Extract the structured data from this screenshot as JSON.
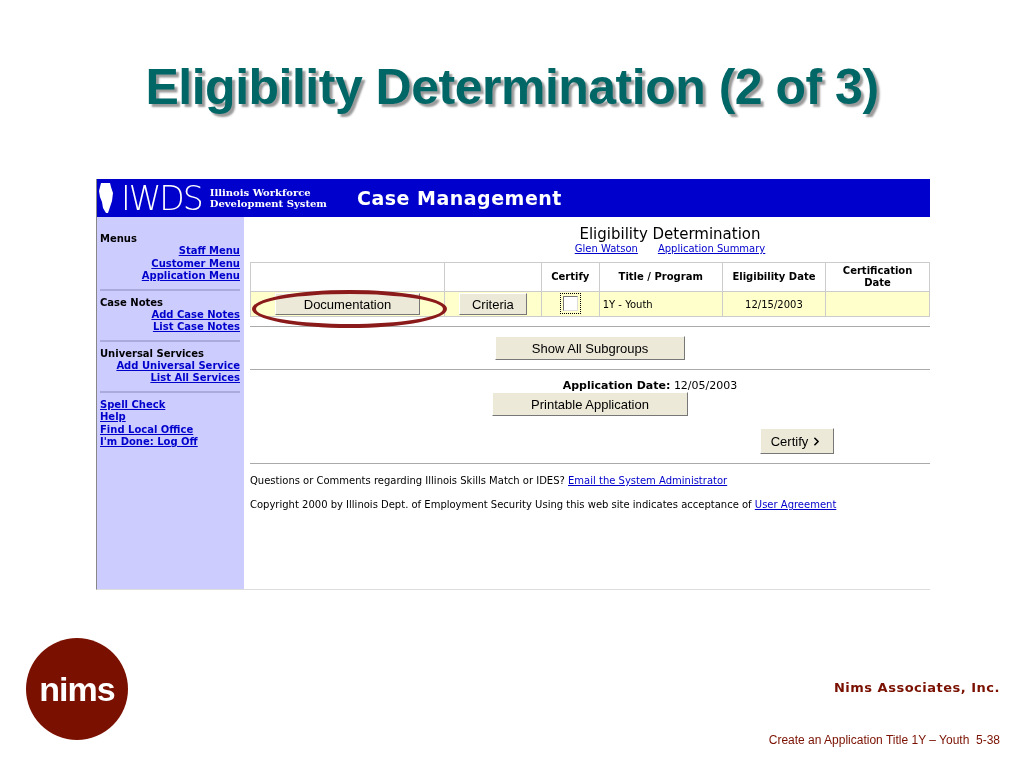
{
  "slide": {
    "title": "Eligibility Determination (2 of 3)"
  },
  "app": {
    "header": {
      "logo_mark": "IWDS",
      "logo_lines": [
        "Illinois Workforce",
        "Development System"
      ],
      "title": "Case Management"
    },
    "sidebar": {
      "sections": [
        {
          "heading": "Menus",
          "links": [
            "Staff Menu",
            "Customer Menu",
            "Application Menu"
          ]
        },
        {
          "heading": "Case Notes",
          "links": [
            "Add Case Notes",
            "List Case Notes"
          ]
        },
        {
          "heading": "Universal Services",
          "links": [
            "Add Universal Service",
            "List All Services"
          ]
        }
      ],
      "bottom_links": [
        "Spell Check",
        "Help",
        "Find Local Office",
        "I'm Done: Log Off"
      ]
    },
    "page": {
      "title": "Eligibility Determination",
      "links": [
        "Glen Watson",
        "Application Summary"
      ],
      "table": {
        "columns": [
          "Certify",
          "Title / Program",
          "Eligibility Date",
          "Certification Date"
        ],
        "rows": [
          {
            "buttons": [
              "Documentation",
              "Criteria"
            ],
            "certify_checked": false,
            "program": "1Y - Youth",
            "eligibility_date": "12/15/2003"
          }
        ]
      },
      "show_all_button": "Show All Subgroups",
      "application_date": {
        "label": "Application Date:",
        "value": "12/05/2003"
      },
      "printable_button": "Printable Application",
      "certify_button": "Certify",
      "footer": {
        "question": "Questions or Comments regarding Illinois Skills Match or IDES?",
        "question_link": "Email the System Administrator",
        "copyright": "Copyright 2000 by Illinois Dept. of Employment Security Using this web site indicates acceptance of",
        "copyright_link": "User Agreement"
      }
    }
  },
  "footer": {
    "logo": "nims",
    "company": "Nims Associates, Inc.",
    "caption": "Create an Application Title 1Y – Youth  5-38"
  }
}
